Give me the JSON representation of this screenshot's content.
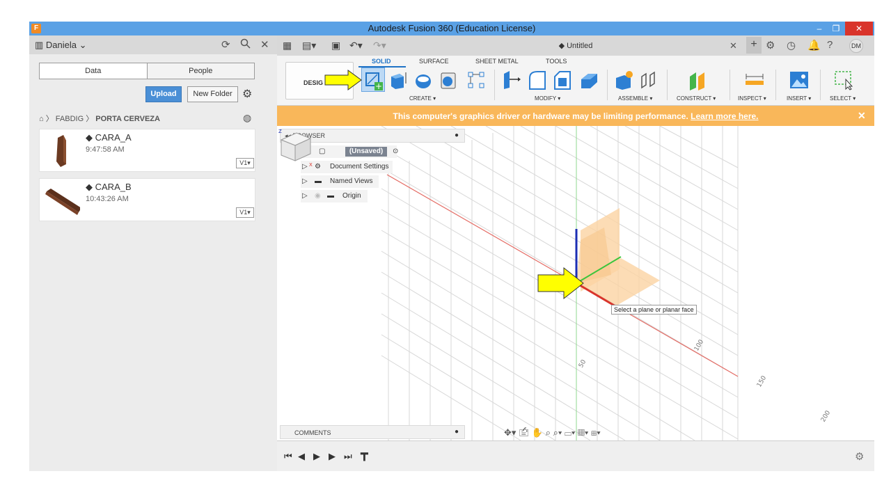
{
  "window": {
    "app_icon": "F",
    "title": "Autodesk Fusion 360 (Education License)",
    "controls": [
      "–",
      "❐",
      "✕"
    ]
  },
  "data_panel": {
    "user": "Daniela",
    "tabs": {
      "data": "Data",
      "people": "People"
    },
    "upload_label": "Upload",
    "new_folder_label": "New Folder",
    "breadcrumb": {
      "project": "FABDIG",
      "folder": "PORTA CERVEZA"
    },
    "files": [
      {
        "name": "CARA_A",
        "time": "9:47:58 AM",
        "version": "V1▾"
      },
      {
        "name": "CARA_B",
        "time": "10:43:26 AM",
        "version": "V1▾"
      }
    ]
  },
  "document": {
    "tab_title": "Untitled",
    "user_initials": "DM"
  },
  "toolbar": {
    "workspace_label": "DESIG",
    "tabs": [
      "SOLID",
      "SURFACE",
      "SHEET METAL",
      "TOOLS"
    ],
    "active_tab": "SOLID",
    "groups": {
      "create": "CREATE ▾",
      "modify": "MODIFY ▾",
      "assemble": "ASSEMBLE ▾",
      "construct": "CONSTRUCT ▾",
      "inspect": "INSPECT ▾",
      "insert": "INSERT ▾",
      "select": "SELECT ▾"
    }
  },
  "warning": {
    "message": "This computer's graphics driver or hardware may be limiting performance.",
    "link": "Learn more here."
  },
  "browser": {
    "title": "BROWSER",
    "root": "(Unsaved)",
    "items": [
      "Document Settings",
      "Named Views",
      "Origin"
    ]
  },
  "canvas": {
    "tooltip": "Select a plane or planar face",
    "ruler_labels": [
      "50",
      "100",
      "150",
      "200",
      "50"
    ]
  },
  "comments": {
    "title": "COMMENTS"
  },
  "colors": {
    "title_bar": "#5aa1e5",
    "accent": "#1f73c6",
    "warning": "#f9b75a",
    "arrow_fill": "#ffff00",
    "x_axis": "#d9342b",
    "z_axis": "#1c2fb4",
    "y_axis": "#3cc43c",
    "plane": "#fbd3a3"
  }
}
